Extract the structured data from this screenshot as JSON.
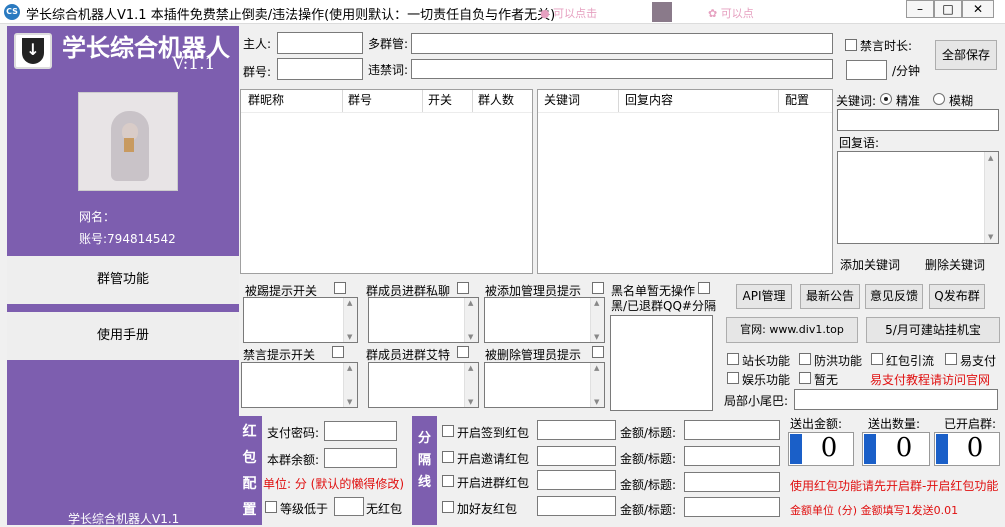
{
  "titlebar": {
    "title": "学长综合机器人V1.1  本插件免费禁止倒卖/违法操作(使用则默认：一切责任自负与作者无关)",
    "pink1": "● 可以点击",
    "pink2": "✿ 可以点"
  },
  "sidebar": {
    "app_name": "学长综合机器人",
    "version": "V:1.1",
    "nickname_label": "网名：",
    "account_label": "账号:794814542",
    "btn_group": "群管功能",
    "btn_manual": "使用手册",
    "footer": "学长综合机器人V1.1"
  },
  "top": {
    "owner_label": "主人:",
    "multi_group_label": "多群管:",
    "mute_duration_label": "禁言时长:",
    "save_all": "全部保存",
    "group_label": "群号:",
    "banned_words_label": "违禁词:",
    "per_min": "/分钟"
  },
  "tables": {
    "group_cols": [
      "群昵称",
      "群号",
      "开关",
      "群人数"
    ],
    "keyword_cols": [
      "关键词",
      "回复内容",
      "配置"
    ]
  },
  "keyword_panel": {
    "kw_label": "关键词:",
    "exact": "精准",
    "fuzzy": "模糊",
    "reply_label": "回复语:",
    "add_btn": "添加关键词",
    "del_btn": "删除关键词"
  },
  "prompts": {
    "kicked": "被踢提示开关",
    "member_private": "群成员进群私聊",
    "added_admin": "被添加管理员提示",
    "blacklist": "黑名单暂无操作",
    "blacklist2": "黑/已退群QQ#分隔",
    "muted": "禁言提示开关",
    "member_at": "群成员进群艾特",
    "removed_admin": "被删除管理员提示"
  },
  "right_buttons": {
    "api": "API管理",
    "news": "最新公告",
    "feedback": "意见反馈",
    "qq_publish": "Q发布群",
    "site": "官网: www.div1.top",
    "rental": "5/月可建站挂机宝"
  },
  "features": {
    "owner_fn": "站长功能",
    "anti_spam": "防洪功能",
    "redbag_guide": "红包引流",
    "easy_pay": "易支付",
    "entertainment": "娱乐功能",
    "none": "暂无",
    "easy_pay_note": "易支付教程请访问官网",
    "tail_label": "局部小尾巴:"
  },
  "redbag": {
    "vertical": [
      "红",
      "包",
      "配",
      "置"
    ],
    "pay_pwd_label": "支付密码:",
    "balance_label": "本群余额:",
    "unit_note": "单位: 分 (默认的懒得修改)",
    "level_label": "等级低于",
    "no_redbag": "无红包",
    "divider_vertical": [
      "分",
      "隔",
      "线"
    ],
    "checkin": "开启签到红包",
    "invite": "开启邀请红包",
    "join": "开启进群红包",
    "add_friend": "加好友红包",
    "amount_title": "金额/标题:"
  },
  "stats": {
    "sent_amount_label": "送出金额:",
    "sent_count_label": "送出数量:",
    "enabled_groups_label": "已开启群:",
    "sent_amount": "0",
    "sent_count": "0",
    "enabled_groups": "0",
    "note1": "使用红包功能请先开启群-开启红包功能",
    "note2": "金额单位 (分) 金额填写1发送0.01"
  },
  "colors": {
    "accent": "#7d5eaf",
    "counter_blue": "#1a5fc8",
    "red_text": "#e01010"
  }
}
